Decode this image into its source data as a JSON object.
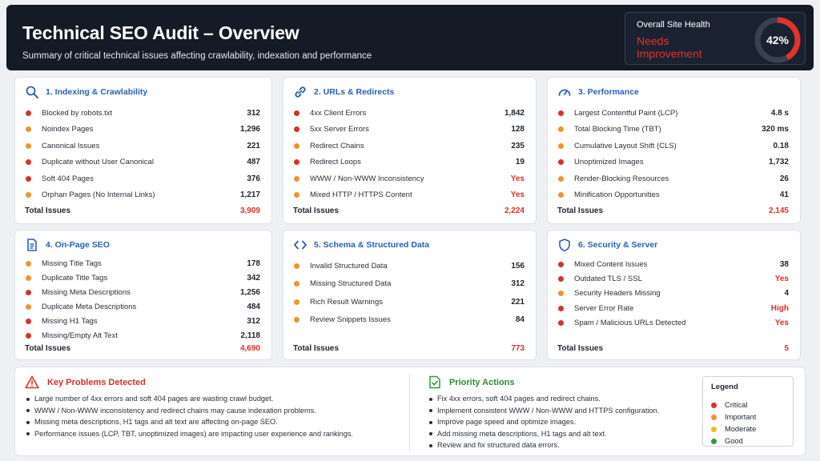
{
  "header": {
    "title": "Technical SEO Audit – Overview",
    "subtitle": "Summary of critical technical issues affecting crawlability, indexation and performance",
    "health_label": "Overall Site Health",
    "health_status": "Needs Improvement",
    "health_percent_text": "42%",
    "health_percent": 42
  },
  "colors": {
    "critical": "#d9302c",
    "important": "#f0952a",
    "moderate": "#e7c21c",
    "good": "#2f9a3d",
    "accent": "#2b5fb3"
  },
  "cards": [
    {
      "title": "1. Indexing & Crawlability",
      "icon": "search-icon",
      "rows": [
        {
          "label": "Blocked by robots.txt",
          "value": "312",
          "severity": "critical"
        },
        {
          "label": "Noindex Pages",
          "value": "1,296",
          "severity": "important"
        },
        {
          "label": "Canonical Issues",
          "value": "221",
          "severity": "important"
        },
        {
          "label": "Duplicate without User Canonical",
          "value": "487",
          "severity": "critical"
        },
        {
          "label": "Soft 404 Pages",
          "value": "376",
          "severity": "critical"
        },
        {
          "label": "Orphan Pages (No Internal Links)",
          "value": "1,217",
          "severity": "important"
        }
      ],
      "total_label": "Total Issues",
      "total_value": "3,909"
    },
    {
      "title": "2. URLs & Redirects",
      "icon": "link-icon",
      "rows": [
        {
          "label": "4xx Client Errors",
          "value": "1,842",
          "severity": "critical"
        },
        {
          "label": "5xx Server Errors",
          "value": "128",
          "severity": "critical"
        },
        {
          "label": "Redirect Chains",
          "value": "235",
          "severity": "important"
        },
        {
          "label": "Redirect Loops",
          "value": "19",
          "severity": "critical"
        },
        {
          "label": "WWW / Non-WWW Inconsistency",
          "value": "Yes",
          "severity": "important"
        },
        {
          "label": "Mixed HTTP / HTTPS Content",
          "value": "Yes",
          "severity": "important"
        }
      ],
      "total_label": "Total Issues",
      "total_value": "2,224"
    },
    {
      "title": "3. Performance",
      "icon": "gauge-icon",
      "rows": [
        {
          "label": "Largest Contentful Paint (LCP)",
          "value": "4.8 s",
          "severity": "critical"
        },
        {
          "label": "Total Blocking Time (TBT)",
          "value": "320 ms",
          "severity": "important"
        },
        {
          "label": "Cumulative Layout Shift (CLS)",
          "value": "0.18",
          "severity": "important"
        },
        {
          "label": "Unoptimized Images",
          "value": "1,732",
          "severity": "critical"
        },
        {
          "label": "Render-Blocking Resources",
          "value": "26",
          "severity": "important"
        },
        {
          "label": "Minification Opportunities",
          "value": "41",
          "severity": "important"
        }
      ],
      "total_label": "Total Issues",
      "total_value": "2,145"
    },
    {
      "title": "4. On-Page SEO",
      "icon": "document-icon",
      "rows": [
        {
          "label": "Missing Title Tags",
          "value": "178",
          "severity": "important"
        },
        {
          "label": "Duplicate Title Tags",
          "value": "342",
          "severity": "important"
        },
        {
          "label": "Missing Meta Descriptions",
          "value": "1,256",
          "severity": "critical"
        },
        {
          "label": "Duplicate Meta Descriptions",
          "value": "484",
          "severity": "important"
        },
        {
          "label": "Missing H1 Tags",
          "value": "312",
          "severity": "critical"
        },
        {
          "label": "Missing/Empty Alt Text",
          "value": "2,118",
          "severity": "critical"
        }
      ],
      "total_label": "Total Issues",
      "total_value": "4,690"
    },
    {
      "title": "5. Schema & Structured Data",
      "icon": "code-icon",
      "rows": [
        {
          "label": "Invalid Structured Data",
          "value": "156",
          "severity": "important"
        },
        {
          "label": "Missing Structured Data",
          "value": "312",
          "severity": "important"
        },
        {
          "label": "Rich Result Warnings",
          "value": "221",
          "severity": "important"
        },
        {
          "label": "Review Snippets Issues",
          "value": "84",
          "severity": "important"
        }
      ],
      "total_label": "Total Issues",
      "total_value": "773"
    },
    {
      "title": "6. Security & Server",
      "icon": "shield-icon",
      "rows": [
        {
          "label": "Mixed Content Issues",
          "value": "38",
          "severity": "critical"
        },
        {
          "label": "Outdated TLS / SSL",
          "value": "Yes",
          "severity": "critical"
        },
        {
          "label": "Security Headers Missing",
          "value": "4",
          "severity": "important"
        },
        {
          "label": "Server Error Rate",
          "value": "High",
          "severity": "critical"
        },
        {
          "label": "Spam / Malicious URLs Detected",
          "value": "Yes",
          "severity": "critical"
        }
      ],
      "total_label": "Total Issues",
      "total_value": "5"
    }
  ],
  "problems": {
    "title": "Key Problems Detected",
    "icon": "warning-icon",
    "items": [
      "Large number of 4xx errors and soft 404 pages are wasting crawl budget.",
      "WWW / Non-WWW inconsistency and redirect chains may cause indexation problems.",
      "Missing meta descriptions, H1 tags and alt text are affecting on-page SEO.",
      "Performance issues (LCP, TBT, unoptimized images) are impacting user experience and rankings."
    ]
  },
  "actions": {
    "title": "Priority Actions",
    "icon": "checklist-icon",
    "items": [
      "Fix 4xx errors, soft 404 pages and redirect chains.",
      "Implement consistent WWW / Non-WWW and HTTPS configuration.",
      "Improve page speed and optimize images.",
      "Add missing meta descriptions, H1 tags and alt text.",
      "Review and fix structured data errors."
    ]
  },
  "legend": {
    "title": "Legend",
    "items": [
      {
        "label": "Critical",
        "severity": "critical"
      },
      {
        "label": "Important",
        "severity": "important"
      },
      {
        "label": "Moderate",
        "severity": "moderate"
      },
      {
        "label": "Good",
        "severity": "good"
      }
    ]
  }
}
